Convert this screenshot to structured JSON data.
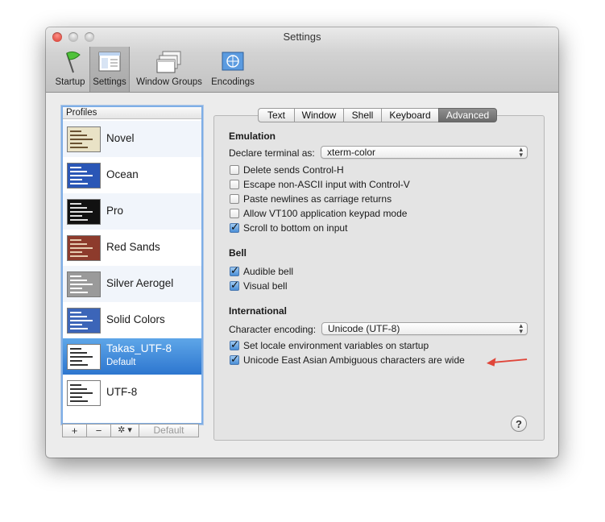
{
  "window": {
    "title": "Settings"
  },
  "toolbar": {
    "items": [
      {
        "label": "Startup"
      },
      {
        "label": "Settings"
      },
      {
        "label": "Window Groups"
      },
      {
        "label": "Encodings"
      }
    ]
  },
  "profiles": {
    "header": "Profiles",
    "items": [
      {
        "name": "Novel",
        "sub": "",
        "thumb_bg": "#e9e2c6",
        "bar": "#6a5232"
      },
      {
        "name": "Ocean",
        "sub": "",
        "thumb_bg": "#2a56b6",
        "bar": "#ffffff"
      },
      {
        "name": "Pro",
        "sub": "",
        "thumb_bg": "#111111",
        "bar": "#dddddd"
      },
      {
        "name": "Red Sands",
        "sub": "",
        "thumb_bg": "#8d3b2c",
        "bar": "#e6cbb0"
      },
      {
        "name": "Silver Aerogel",
        "sub": "",
        "thumb_bg": "#9a9a9a",
        "bar": "#ffffff"
      },
      {
        "name": "Solid Colors",
        "sub": "",
        "thumb_bg": "#3c65b8",
        "bar": "#ffffff"
      },
      {
        "name": "Takas_UTF-8",
        "sub": "Default",
        "thumb_bg": "#ffffff",
        "bar": "#333333"
      },
      {
        "name": "UTF-8",
        "sub": "",
        "thumb_bg": "#ffffff",
        "bar": "#333333"
      }
    ],
    "buttons": {
      "add": "+",
      "remove": "−",
      "gear": "✲ ▾",
      "default": "Default"
    }
  },
  "tabs": [
    "Text",
    "Window",
    "Shell",
    "Keyboard",
    "Advanced"
  ],
  "emulation": {
    "heading": "Emulation",
    "declare_label": "Declare terminal as:",
    "declare_value": "xterm-color",
    "options": [
      {
        "label": "Delete sends Control-H",
        "checked": false
      },
      {
        "label": "Escape non-ASCII input with Control-V",
        "checked": false
      },
      {
        "label": "Paste newlines as carriage returns",
        "checked": false
      },
      {
        "label": "Allow VT100 application keypad mode",
        "checked": false
      },
      {
        "label": "Scroll to bottom on input",
        "checked": true
      }
    ]
  },
  "bell": {
    "heading": "Bell",
    "options": [
      {
        "label": "Audible bell",
        "checked": true
      },
      {
        "label": "Visual bell",
        "checked": true
      }
    ]
  },
  "international": {
    "heading": "International",
    "encoding_label": "Character encoding:",
    "encoding_value": "Unicode (UTF-8)",
    "options": [
      {
        "label": "Set locale environment variables on startup",
        "checked": true
      },
      {
        "label": "Unicode East Asian Ambiguous characters are wide",
        "checked": true
      }
    ]
  },
  "help": {
    "label": "?"
  },
  "colors": {
    "accent": "#2d76cf",
    "arrow": "#e0463a"
  }
}
